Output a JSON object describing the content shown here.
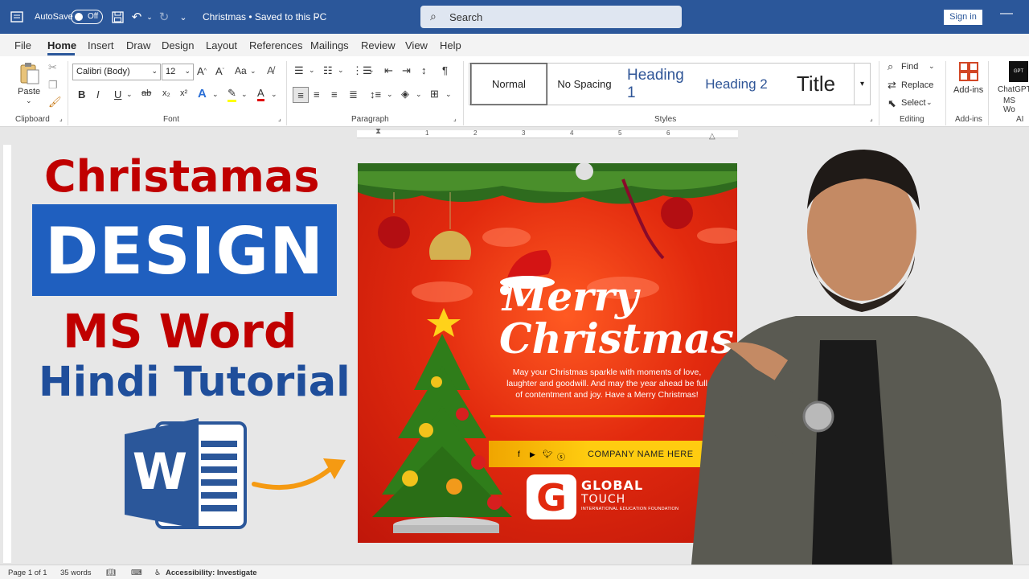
{
  "titlebar": {
    "autosave_label": "AutoSave",
    "autosave_state": "Off",
    "doc_title": "Christmas • Saved to this PC",
    "search_placeholder": "Search",
    "signin_label": "Sign in"
  },
  "menu": {
    "tabs": [
      "File",
      "Home",
      "Insert",
      "Draw",
      "Design",
      "Layout",
      "References",
      "Mailings",
      "Review",
      "View",
      "Help"
    ],
    "active": "Home"
  },
  "ribbon": {
    "clipboard": {
      "paste_label": "Paste",
      "group_label": "Clipboard"
    },
    "font": {
      "font_name": "Calibri (Body)",
      "font_size": "12",
      "group_label": "Font",
      "case_label": "Aa"
    },
    "paragraph": {
      "group_label": "Paragraph"
    },
    "styles": {
      "items": [
        "Normal",
        "No Spacing",
        "Heading 1",
        "Heading 2",
        "Title"
      ],
      "group_label": "Styles"
    },
    "editing": {
      "find": "Find",
      "replace": "Replace",
      "select": "Select",
      "group_label": "Editing"
    },
    "addins": {
      "label": "Add-ins",
      "group_label": "Add-ins"
    },
    "ai": {
      "label_line1": "ChatGPT",
      "label_line2": "MS Wo",
      "group_label": "AI"
    }
  },
  "ruler": {
    "numbers": [
      "1",
      "2",
      "3",
      "4",
      "5",
      "6"
    ]
  },
  "thumbnail": {
    "line1": "Christamas",
    "line2": "DESIGN",
    "line3": "MS Word",
    "line4": "Hindi Tutorial"
  },
  "card": {
    "merry": "Merry",
    "christmas": "Christmas",
    "message_line1": "May your Christmas sparkle with moments of love,",
    "message_line2": "laughter and goodwill. And may the year ahead be full",
    "message_line3": "of contentment and joy. Have a Merry Christmas!",
    "company": "COMPANY NAME HERE",
    "logo_letter": "G",
    "brand_line1": "GLOBAL",
    "brand_line2": "TOUCH",
    "brand_line3": "INTERNATIONAL EDUCATION FOUNDATION"
  },
  "status": {
    "page": "Page 1 of 1",
    "words": "35 words",
    "accessibility": "Accessibility: Investigate"
  },
  "colors": {
    "word_blue": "#2b579a",
    "title_red": "#c00000",
    "banner_blue": "#1f5fbf",
    "hindi_blue": "#1f4e9b",
    "card_red": "#e22a0e",
    "card_yellow": "#ffcc10"
  }
}
